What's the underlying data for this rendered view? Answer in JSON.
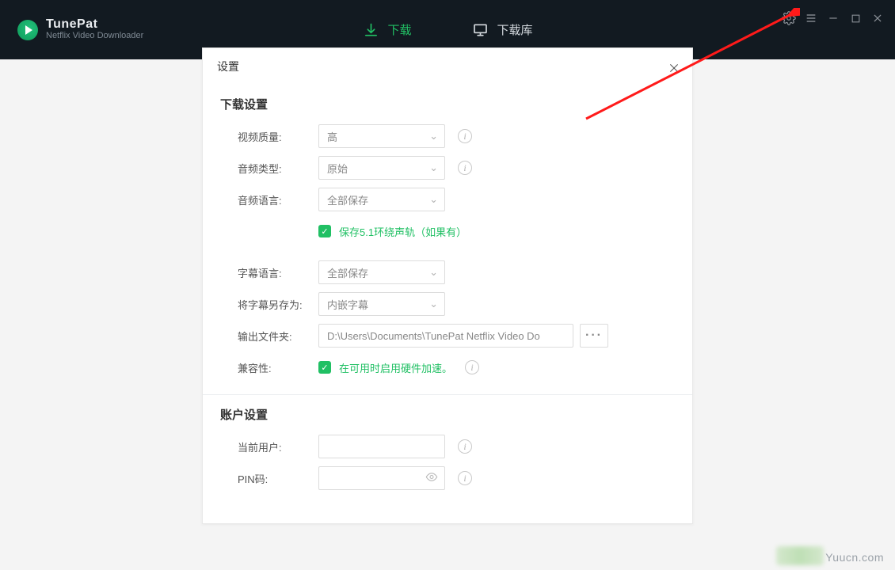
{
  "app": {
    "title": "TunePat",
    "subtitle": "Netflix Video Downloader"
  },
  "nav": {
    "download": "下载",
    "library": "下载库"
  },
  "modal": {
    "title": "设置",
    "section_download": "下载设置",
    "section_account": "账户设置"
  },
  "labels": {
    "video_quality": "视频质量:",
    "audio_type": "音频类型:",
    "audio_lang": "音频语言:",
    "sub_lang": "字幕语言:",
    "save_sub_as": "将字幕另存为:",
    "output_folder": "输出文件夹:",
    "compatibility": "兼容性:",
    "current_user": "当前用户:",
    "pin": "PIN码:"
  },
  "values": {
    "video_quality": "高",
    "audio_type": "原始",
    "audio_lang": "全部保存",
    "sub_lang": "全部保存",
    "save_sub_as": "内嵌字幕",
    "output_folder": "D:\\Users\\Documents\\TunePat Netflix Video Do",
    "current_user": "",
    "pin": ""
  },
  "checkboxes": {
    "surround": "保存5.1环绕声轨（如果有）",
    "hwaccel": "在可用时启用硬件加速。"
  },
  "watermark": "Yuucn.com",
  "colors": {
    "accent": "#21c064",
    "titlebar": "#121a21"
  }
}
